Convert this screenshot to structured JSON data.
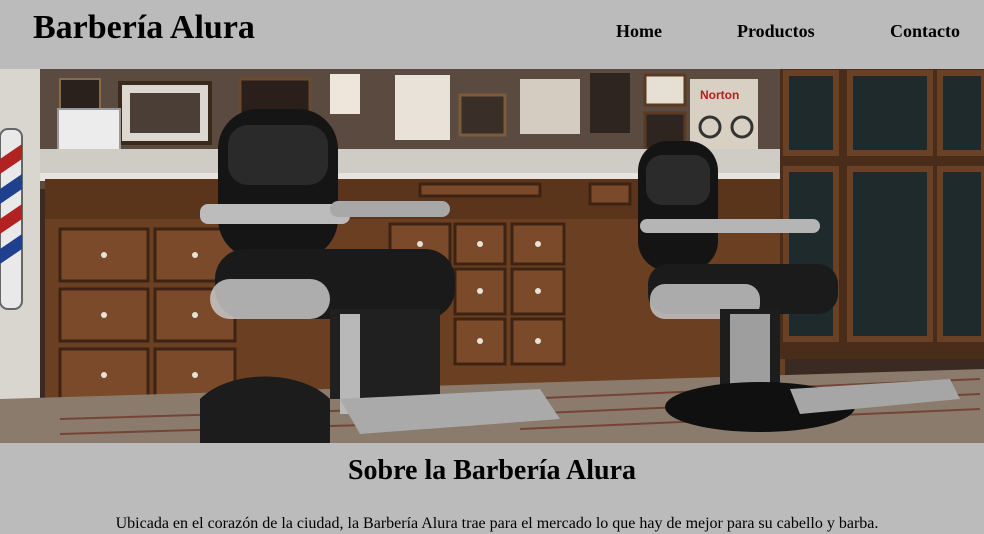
{
  "header": {
    "brand": "Barbería Alura",
    "nav": [
      {
        "label": "Home"
      },
      {
        "label": "Productos"
      },
      {
        "label": "Contacto"
      }
    ]
  },
  "banner": {
    "image": "barbershop-interior-photo",
    "sign_text": "Norton"
  },
  "about": {
    "title": "Sobre la Barbería Alura",
    "text": "Ubicada en el corazón de la ciudad, la Barbería Alura trae para el mercado lo que hay de mejor para su cabello y barba."
  }
}
